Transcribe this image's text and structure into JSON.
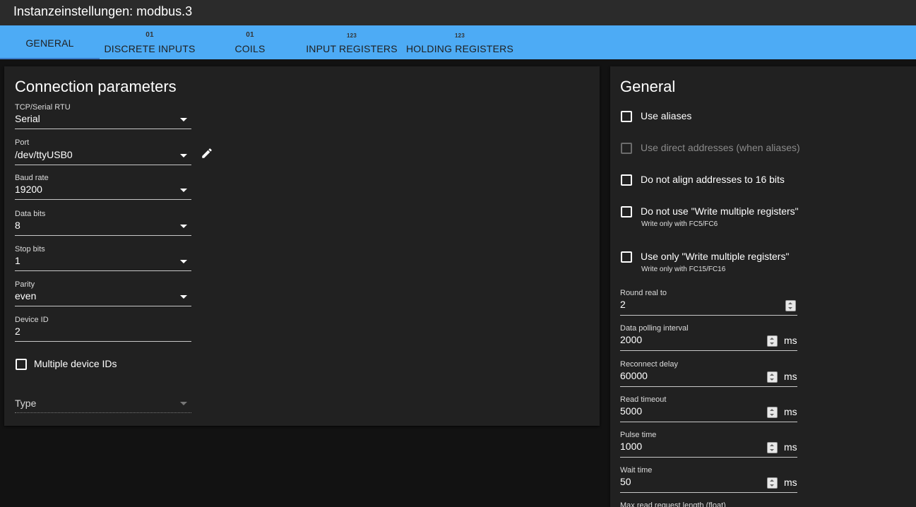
{
  "window": {
    "title": "Instanzeinstellungen: modbus.3"
  },
  "tabs": [
    {
      "label": "GENERAL",
      "icon": ""
    },
    {
      "label": "DISCRETE INPUTS",
      "icon": "01"
    },
    {
      "label": "COILS",
      "icon": "01"
    },
    {
      "label": "INPUT REGISTERS",
      "icon": "123"
    },
    {
      "label": "HOLDING REGISTERS",
      "icon": "123"
    }
  ],
  "connection": {
    "title": "Connection parameters",
    "fields": [
      {
        "label": "TCP/Serial RTU",
        "value": "Serial"
      },
      {
        "label": "Port",
        "value": "/dev/ttyUSB0"
      },
      {
        "label": "Baud rate",
        "value": "19200"
      },
      {
        "label": "Data bits",
        "value": "8"
      },
      {
        "label": "Stop bits",
        "value": "1"
      },
      {
        "label": "Parity",
        "value": "even"
      },
      {
        "label": "Device ID",
        "value": "2"
      }
    ],
    "multiple_ids_label": "Multiple device IDs",
    "type_label": "Type"
  },
  "general": {
    "title": "General",
    "checkboxes": [
      {
        "label": "Use aliases",
        "hint": "",
        "disabled": false
      },
      {
        "label": "Use direct addresses (when aliases)",
        "hint": "",
        "disabled": true
      },
      {
        "label": "Do not align addresses to 16 bits",
        "hint": "",
        "disabled": false
      },
      {
        "label": "Do not use \"Write multiple registers\"",
        "hint": "Write only with FC5/FC6",
        "disabled": false
      },
      {
        "label": "Use only \"Write multiple registers\"",
        "hint": "Write only with FC15/FC16",
        "disabled": false
      }
    ],
    "numbers": [
      {
        "label": "Round real to",
        "value": "2",
        "unit": ""
      },
      {
        "label": "Data polling interval",
        "value": "2000",
        "unit": "ms"
      },
      {
        "label": "Reconnect delay",
        "value": "60000",
        "unit": "ms"
      },
      {
        "label": "Read timeout",
        "value": "5000",
        "unit": "ms"
      },
      {
        "label": "Pulse time",
        "value": "1000",
        "unit": "ms"
      },
      {
        "label": "Wait time",
        "value": "50",
        "unit": "ms"
      }
    ],
    "cutoff_label": "Max read request length (float)"
  }
}
